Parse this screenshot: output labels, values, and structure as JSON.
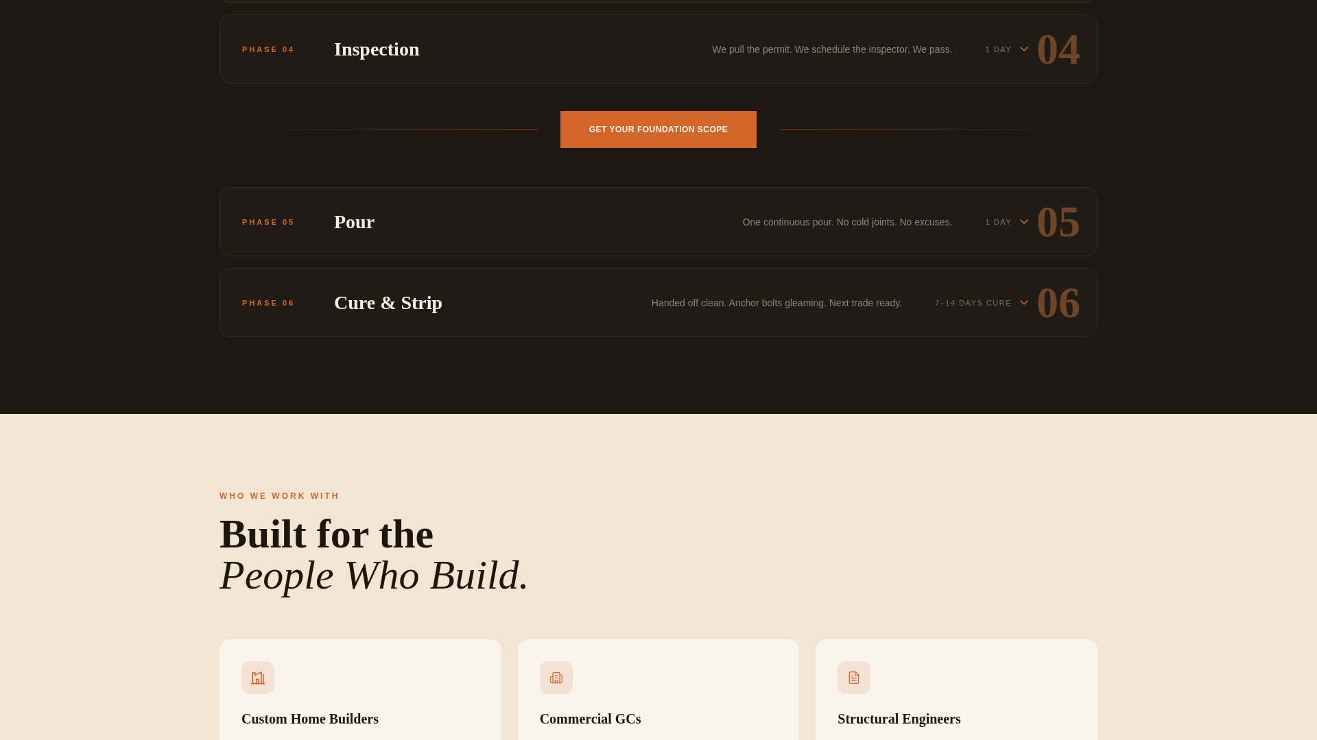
{
  "process": {
    "items": [
      {
        "kind": "phase",
        "label": "PHASE 04",
        "title": "Inspection",
        "description": "We pull the permit. We schedule the inspector. We pass.",
        "duration": "1 DAY",
        "number": "04",
        "expanded": false
      },
      {
        "kind": "cta",
        "label": "GET YOUR FOUNDATION SCOPE"
      },
      {
        "kind": "phase",
        "label": "PHASE 05",
        "title": "Pour",
        "description": "One continuous pour. No cold joints. No excuses.",
        "duration": "1 DAY",
        "number": "05",
        "expanded": false
      },
      {
        "kind": "phase",
        "label": "PHASE 06",
        "title": "Cure & Strip",
        "description": "Handed off clean. Anchor bolts gleaming. Next trade ready.",
        "duration": "7–14 DAYS CURE",
        "number": "06",
        "expanded": false
      }
    ]
  },
  "audience": {
    "eyebrow": "WHO WE WORK WITH",
    "heading": "Built for the *People Who Build.*",
    "cards": [
      {
        "title": "Custom Home Builders"
      },
      {
        "title": "Commercial GCs"
      },
      {
        "title": "Structural Engineers"
      }
    ]
  }
}
